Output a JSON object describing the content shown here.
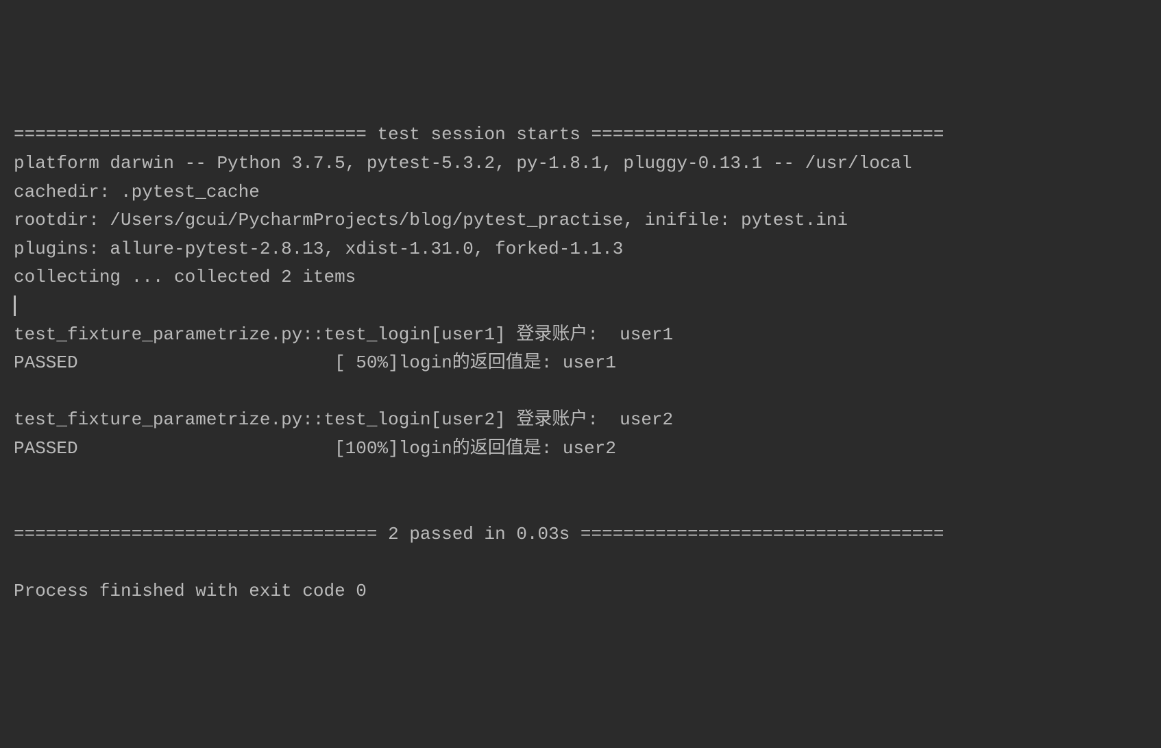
{
  "terminal": {
    "lines": [
      "================================= test session starts =================================",
      "platform darwin -- Python 3.7.5, pytest-5.3.2, py-1.8.1, pluggy-0.13.1 -- /usr/local",
      "cachedir: .pytest_cache",
      "rootdir: /Users/gcui/PycharmProjects/blog/pytest_practise, inifile: pytest.ini",
      "plugins: allure-pytest-2.8.13, xdist-1.31.0, forked-1.1.3",
      "collecting ... collected 2 items",
      "",
      "test_fixture_parametrize.py::test_login[user1] 登录账户:  user1",
      "PASSED                        [ 50%]login的返回值是: user1",
      "",
      "test_fixture_parametrize.py::test_login[user2] 登录账户:  user2",
      "PASSED                        [100%]login的返回值是: user2",
      "",
      "",
      "================================== 2 passed in 0.03s ==================================",
      "",
      "Process finished with exit code 0"
    ]
  }
}
